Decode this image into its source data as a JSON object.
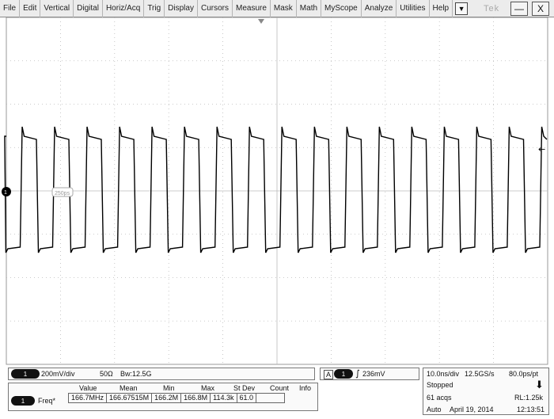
{
  "menubar": {
    "items": [
      "File",
      "Edit",
      "Vertical",
      "Digital",
      "Horiz/Acq",
      "Trig",
      "Display",
      "Cursors",
      "Measure",
      "Mask",
      "Math",
      "MyScope",
      "Analyze",
      "Utilities",
      "Help"
    ],
    "dropdown_glyph": "▼",
    "brand": "Tek",
    "minimize": "—",
    "close": "X"
  },
  "graticule": {
    "channel_marker_label": "1",
    "trigger_arrow": "←",
    "reference_label": "250ps"
  },
  "channel_panel": {
    "channel": "1",
    "scale": "200mV/div",
    "impedance": "50Ω",
    "bandwidth": "Bw:12.5G"
  },
  "trigger_panel": {
    "source": "A",
    "channel": "1",
    "slope_glyph": "∫",
    "level": "236mV"
  },
  "measurement": {
    "channel": "1",
    "headers": [
      "Value",
      "Mean",
      "Min",
      "Max",
      "St Dev",
      "Count",
      "Info"
    ],
    "name": "Freq*",
    "values": [
      "166.7MHz",
      "166.67515M",
      "166.2M",
      "166.8M",
      "114.3k",
      "61.0",
      ""
    ]
  },
  "horizontal_panel": {
    "timebase": "10.0ns/div",
    "sample_rate": "12.5GS/s",
    "resolution": "80.0ps/pt",
    "state": "Stopped",
    "acqs": "61 acqs",
    "record_length": "RL:1.25k",
    "mode": "Auto",
    "date": "April 19, 2014",
    "time": "12:13:51"
  }
}
